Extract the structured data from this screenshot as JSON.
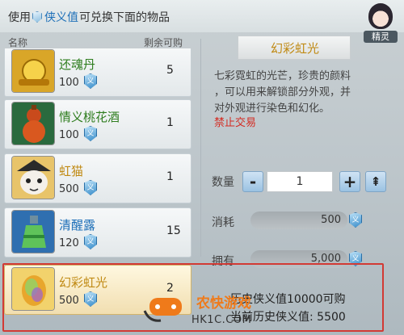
{
  "header": {
    "prefix": "使用",
    "currency": "侠义值",
    "suffix": "可兑换下面的物品"
  },
  "elf": {
    "label": "精灵",
    "icon": "fairy-avatar-icon"
  },
  "columns": {
    "name": "名称",
    "remaining": "剩余可购"
  },
  "items": [
    {
      "name": "还魂丹",
      "price": "100",
      "remaining": "5",
      "icon": "golden-pill-icon",
      "name_color": "#2e7d1e"
    },
    {
      "name": "情义桃花酒",
      "price": "100",
      "remaining": "1",
      "icon": "wine-gourd-icon",
      "name_color": "#2e7d1e"
    },
    {
      "name": "虹猫",
      "price": "500",
      "remaining": "1",
      "icon": "cat-icon",
      "name_color": "#c08a14"
    },
    {
      "name": "清醒露",
      "price": "120",
      "remaining": "15",
      "icon": "potion-bottle-icon",
      "name_color": "#1d6fb8"
    },
    {
      "name": "幻彩虹光",
      "price": "500",
      "remaining": "2",
      "icon": "rainbow-egg-icon",
      "name_color": "#c08a14"
    }
  ],
  "detail": {
    "title": "幻彩虹光",
    "desc_line1": "七彩霓虹的光芒，珍贵的颜料",
    "desc_line2": "，可以用来解锁部分外观，并",
    "desc_line3": "对外观进行染色和幻化。",
    "warning": "禁止交易"
  },
  "quantity": {
    "label": "数量",
    "value": "1",
    "minus": "-",
    "plus": "+",
    "max": "⇞"
  },
  "cost": {
    "label": "消耗",
    "value": "500"
  },
  "owned": {
    "label": "拥有",
    "value": "5,000"
  },
  "history": {
    "line1": "历史侠义值10000可购",
    "line2": "当前历史侠义值: 5500"
  },
  "watermark": {
    "main": "农快游戏",
    "url": "HK1C.COM"
  },
  "colors": {
    "highlight_box": "#d23a34",
    "currency_blue": "#1d6fb8",
    "warning_red": "#d42b22"
  }
}
